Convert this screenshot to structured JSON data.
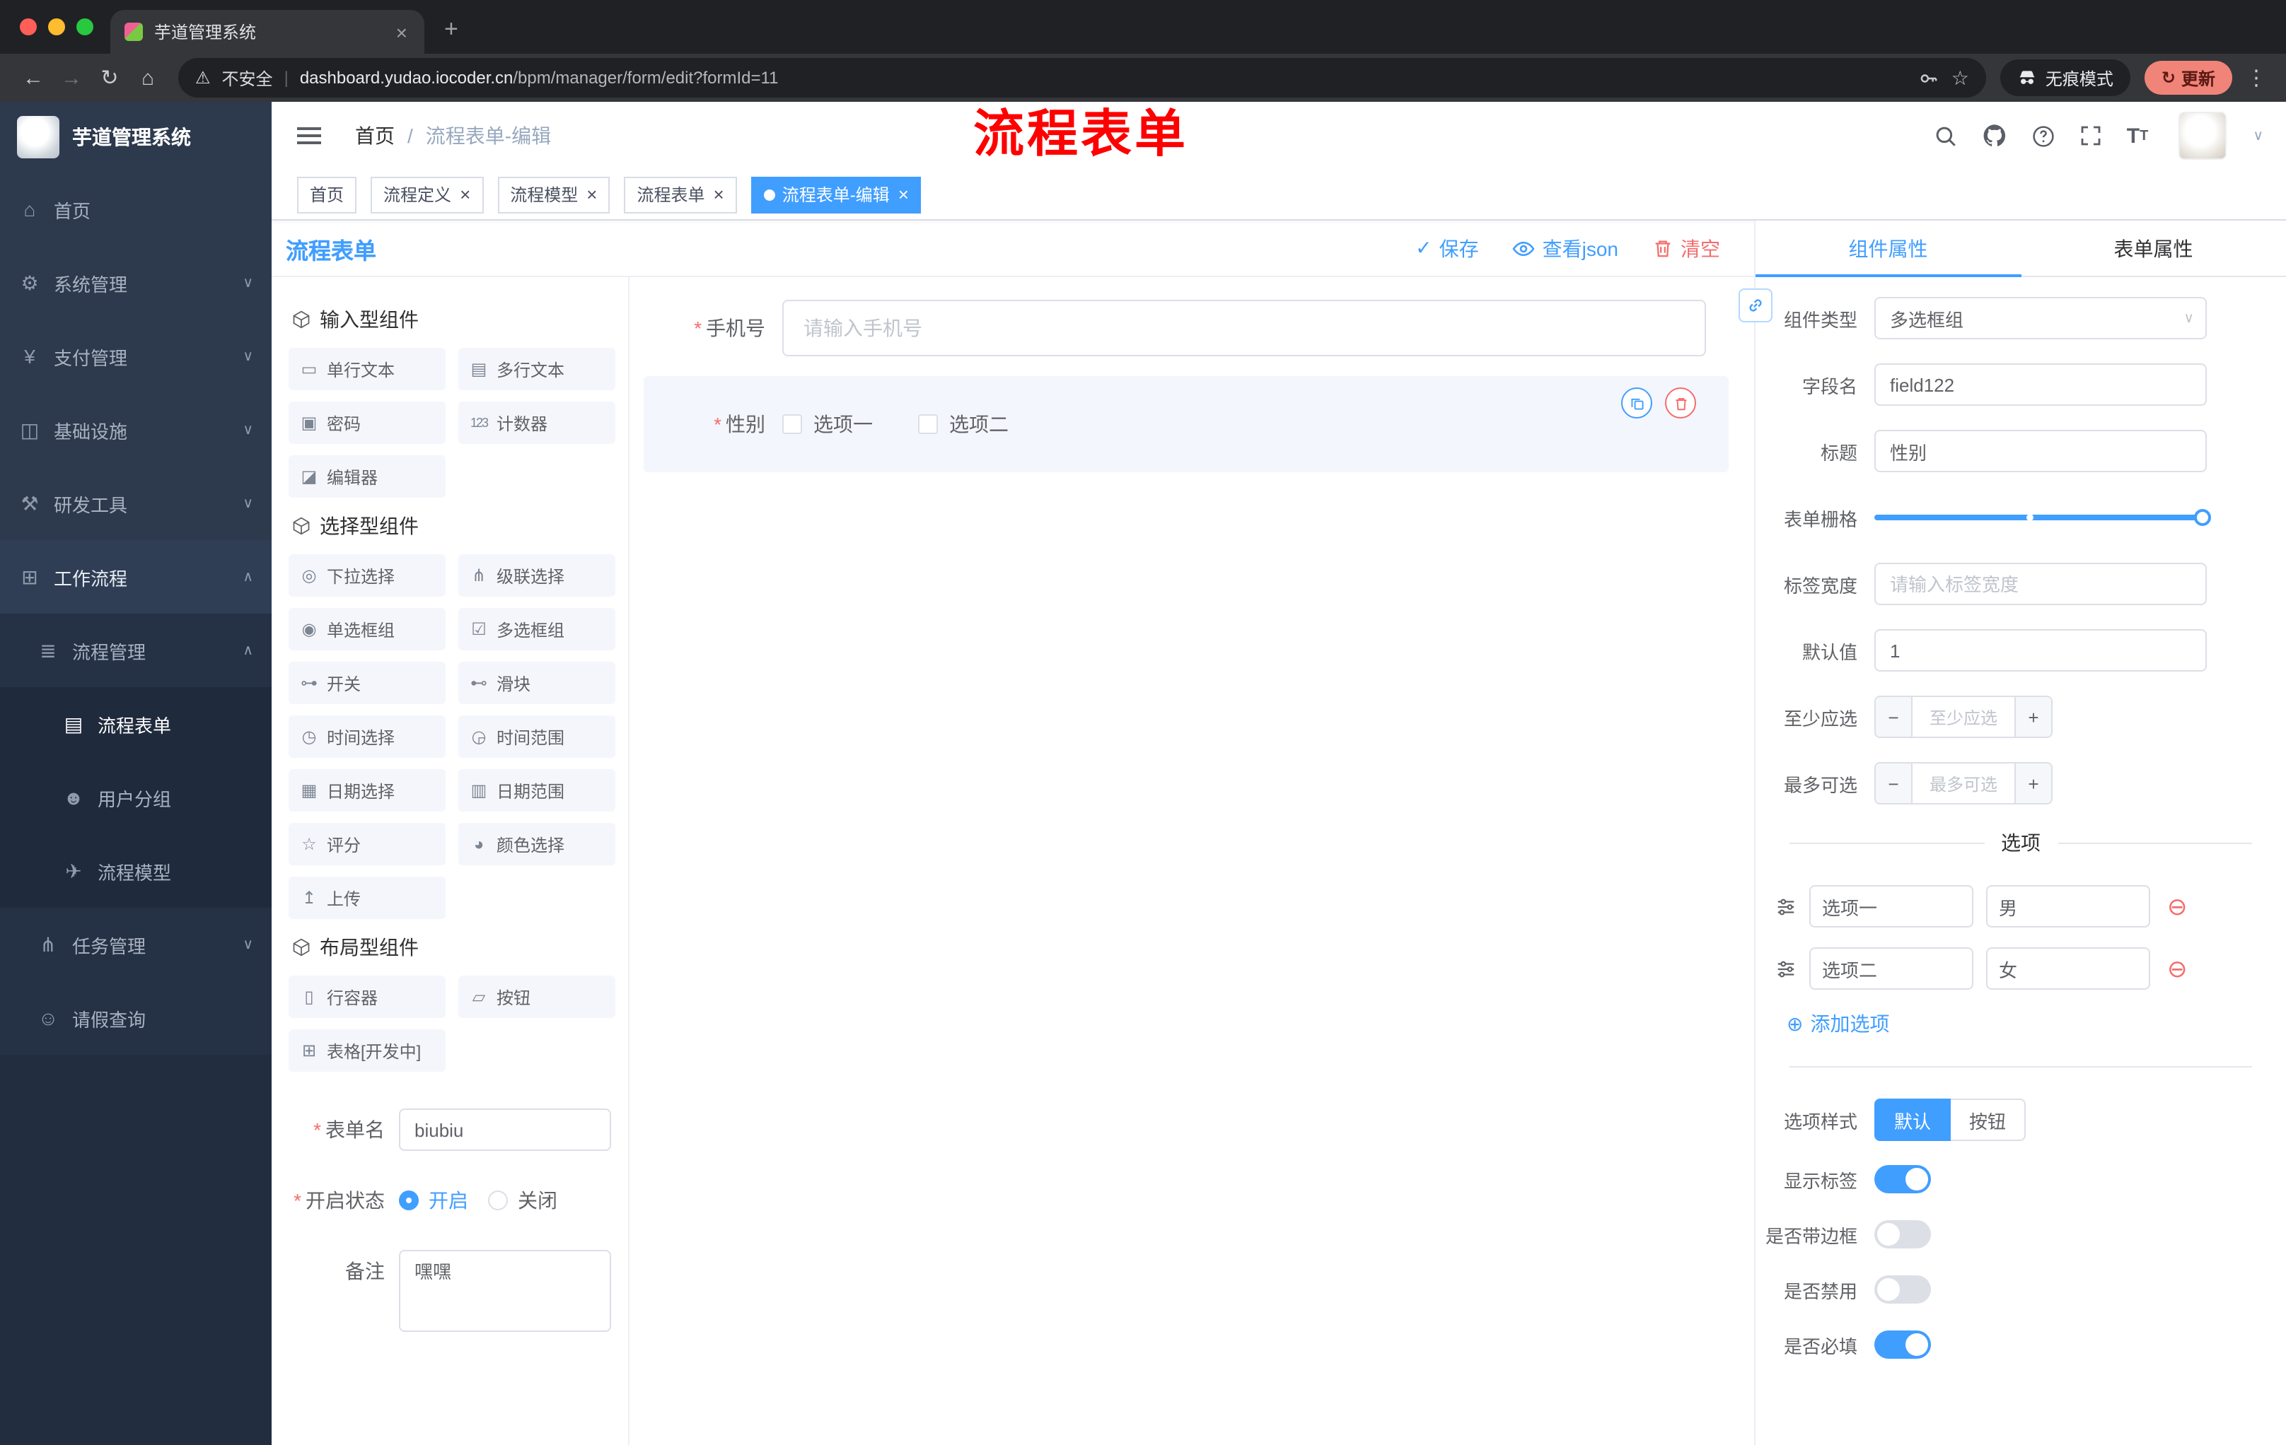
{
  "browser": {
    "tab_title": "芋道管理系统",
    "security_label": "不安全",
    "url_host": "dashboard.yudao.iocoder.cn",
    "url_path": "/bpm/manager/form/edit?formId=11",
    "incognito_label": "无痕模式",
    "update_label": "更新"
  },
  "sidebar": {
    "logo_title": "芋道管理系统",
    "items": [
      {
        "label": "首页",
        "icon": "⌂",
        "chevron": ""
      },
      {
        "label": "系统管理",
        "icon": "⚙",
        "chevron": "∨"
      },
      {
        "label": "支付管理",
        "icon": "¥",
        "chevron": "∨"
      },
      {
        "label": "基础设施",
        "icon": "◫",
        "chevron": "∨"
      },
      {
        "label": "研发工具",
        "icon": "⚒",
        "chevron": "∨"
      },
      {
        "label": "工作流程",
        "icon": "⊞",
        "chevron": "∧"
      },
      {
        "label": "流程管理",
        "icon": "≣",
        "chevron": "∧"
      },
      {
        "label": "流程表单",
        "icon": "▤",
        "chevron": ""
      },
      {
        "label": "用户分组",
        "icon": "☻",
        "chevron": ""
      },
      {
        "label": "流程模型",
        "icon": "✈",
        "chevron": ""
      },
      {
        "label": "任务管理",
        "icon": "⋔",
        "chevron": "∨"
      },
      {
        "label": "请假查询",
        "icon": "☺",
        "chevron": ""
      }
    ]
  },
  "header": {
    "breadcrumb_home": "首页",
    "breadcrumb_sep": "/",
    "breadcrumb_current": "流程表单-编辑",
    "annotation": "流程表单"
  },
  "tags": [
    {
      "label": "首页"
    },
    {
      "label": "流程定义"
    },
    {
      "label": "流程模型"
    },
    {
      "label": "流程表单"
    },
    {
      "label": "流程表单-编辑"
    }
  ],
  "designer": {
    "title": "流程表单",
    "actions": {
      "save": "保存",
      "view_json": "查看json",
      "clear": "清空"
    },
    "palette": {
      "sections": [
        {
          "title": "输入型组件",
          "items": [
            {
              "label": "单行文本",
              "icon": "▭"
            },
            {
              "label": "多行文本",
              "icon": "▤"
            },
            {
              "label": "密码",
              "icon": "▣"
            },
            {
              "label": "计数器",
              "icon": "123"
            },
            {
              "label": "编辑器",
              "icon": "◪"
            }
          ]
        },
        {
          "title": "选择型组件",
          "items": [
            {
              "label": "下拉选择",
              "icon": "◎"
            },
            {
              "label": "级联选择",
              "icon": "⋔"
            },
            {
              "label": "单选框组",
              "icon": "◉"
            },
            {
              "label": "多选框组",
              "icon": "☑"
            },
            {
              "label": "开关",
              "icon": "⊶"
            },
            {
              "label": "滑块",
              "icon": "⊷"
            },
            {
              "label": "时间选择",
              "icon": "◷"
            },
            {
              "label": "时间范围",
              "icon": "◶"
            },
            {
              "label": "日期选择",
              "icon": "▦"
            },
            {
              "label": "日期范围",
              "icon": "▥"
            },
            {
              "label": "评分",
              "icon": "☆"
            },
            {
              "label": "颜色选择",
              "icon": "◕"
            },
            {
              "label": "上传",
              "icon": "↥"
            }
          ]
        },
        {
          "title": "布局型组件",
          "items": [
            {
              "label": "行容器",
              "icon": "▯"
            },
            {
              "label": "按钮",
              "icon": "▱"
            },
            {
              "label": "表格[开发中]",
              "icon": "⊞"
            }
          ]
        }
      ]
    },
    "meta": {
      "name_label": "表单名",
      "name_value": "biubiu",
      "status_label": "开启状态",
      "status_on": "开启",
      "status_off": "关闭",
      "remark_label": "备注",
      "remark_value": "嘿嘿"
    },
    "canvas": {
      "phone_label": "手机号",
      "phone_placeholder": "请输入手机号",
      "gender_label": "性别",
      "gender_options": [
        "选项一",
        "选项二"
      ]
    },
    "props": {
      "tab_component": "组件属性",
      "tab_form": "表单属性",
      "component_type_label": "组件类型",
      "component_type_value": "多选框组",
      "field_name_label": "字段名",
      "field_name_value": "field122",
      "title_label": "标题",
      "title_value": "性别",
      "grid_label": "表单栅格",
      "label_width_label": "标签宽度",
      "label_width_placeholder": "请输入标签宽度",
      "default_label": "默认值",
      "default_value": "1",
      "min_label": "至少应选",
      "min_placeholder": "至少应选",
      "max_label": "最多可选",
      "max_placeholder": "最多可选",
      "options_title": "选项",
      "options": [
        {
          "label": "选项一",
          "value": "男"
        },
        {
          "label": "选项二",
          "value": "女"
        }
      ],
      "add_option": "添加选项",
      "style_label": "选项样式",
      "style_default": "默认",
      "style_button": "按钮",
      "switch_show_label": "显示标签",
      "switch_border": "是否带边框",
      "switch_disabled": "是否禁用",
      "switch_required": "是否必填"
    }
  },
  "icons": {
    "close": "×",
    "plus": "+",
    "back": "←",
    "forward": "→",
    "reload": "↻",
    "home": "⌂",
    "warning": "⚠",
    "pipe": "|",
    "star": "☆",
    "dots": "⋮",
    "caret_down": "∨",
    "check": "✓",
    "select_caret": "∨",
    "minus": "−",
    "plus_small": "+",
    "remove_circle": "⊖",
    "add_circle": "⊕",
    "asterisk": "*"
  },
  "colors": {
    "primary": "#409eff",
    "danger": "#f56c6c",
    "annotation": "#fe0000"
  }
}
